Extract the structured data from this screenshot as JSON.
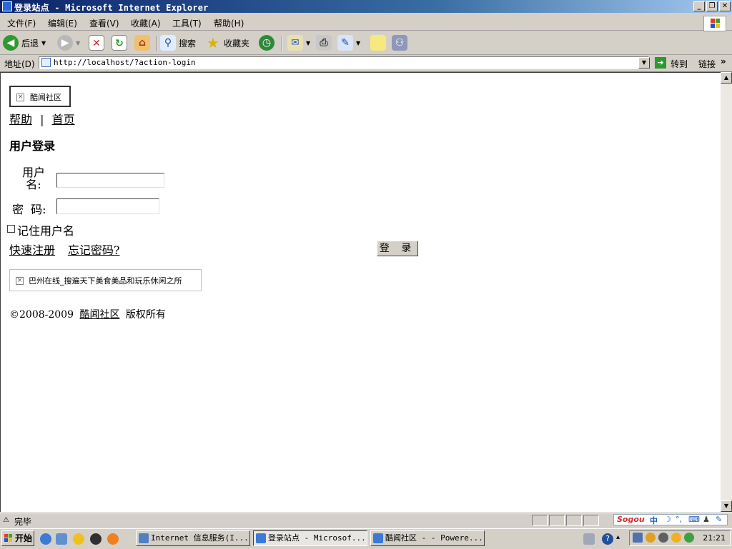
{
  "window": {
    "title": "登录站点 - Microsoft Internet Explorer"
  },
  "menu": {
    "items": [
      "文件(F)",
      "编辑(E)",
      "查看(V)",
      "收藏(A)",
      "工具(T)",
      "帮助(H)"
    ]
  },
  "toolbar": {
    "back_label": "后退",
    "search_label": "搜索",
    "favorites_label": "收藏夹"
  },
  "address": {
    "label": "地址(D)",
    "url": "http://localhost/?action-login",
    "go_label": "转到",
    "links_label": "链接"
  },
  "page": {
    "logo_alt": "酷闻社区",
    "nav": {
      "help": "帮助",
      "separator": "|",
      "home": "首页"
    },
    "heading": "用户登录",
    "form": {
      "username_label_line1": "用户",
      "username_label_line2": "名:",
      "password_label": "密  码:",
      "remember_label": "记住用户名",
      "register_link": "快速注册",
      "forgot_link": "忘记密码?",
      "login_button": "登 录"
    },
    "ad_alt": "巴州在线_搜遍天下美食美品和玩乐休闲之所",
    "footer": {
      "copyright": "©2008-2009",
      "site_link": "酷闻社区",
      "rights": "版权所有"
    }
  },
  "status": {
    "text": "完毕"
  },
  "taskbar": {
    "start_label": "开始",
    "tasks": [
      "Internet 信息服务(I...",
      "登录站点 - Microsof...",
      "酷闻社区 - - Powere..."
    ],
    "clock": "21:21"
  },
  "ime": {
    "brand": "Sogou",
    "mode": "中"
  }
}
